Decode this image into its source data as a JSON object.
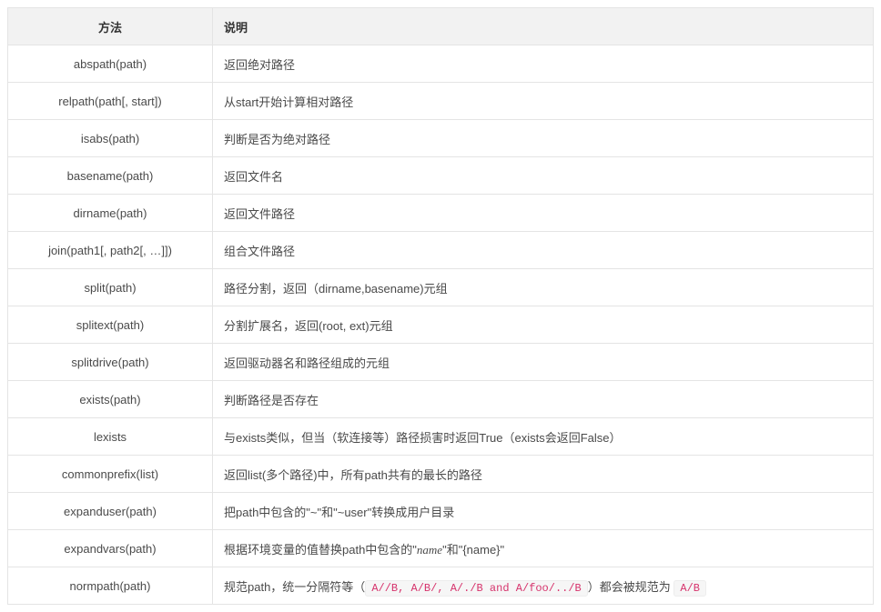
{
  "table": {
    "headers": {
      "method": "方法",
      "desc": "说明"
    },
    "rows": [
      {
        "method": "abspath(path)",
        "desc": "返回绝对路径"
      },
      {
        "method": "relpath(path[, start])",
        "desc": "从start开始计算相对路径"
      },
      {
        "method": "isabs(path)",
        "desc": "判断是否为绝对路径"
      },
      {
        "method": "basename(path)",
        "desc": "返回文件名"
      },
      {
        "method": "dirname(path)",
        "desc": "返回文件路径"
      },
      {
        "method": "join(path1[, path2[, …]])",
        "desc": "组合文件路径"
      },
      {
        "method": "split(path)",
        "desc": "路径分割，返回（dirname,basename)元组"
      },
      {
        "method": "splitext(path)",
        "desc": "分割扩展名，返回(root, ext)元组"
      },
      {
        "method": "splitdrive(path)",
        "desc": "返回驱动器名和路径组成的元组"
      },
      {
        "method": "exists(path)",
        "desc": "判断路径是否存在"
      },
      {
        "method": "lexists",
        "desc": "与exists类似，但当（软连接等）路径损害时返回True（exists会返回False）"
      },
      {
        "method": "commonprefix(list)",
        "desc": "返回list(多个路径)中，所有path共有的最长的路径"
      },
      {
        "method": "expanduser(path)",
        "desc": "把path中包含的\"~\"和\"~user\"转换成用户目录"
      },
      {
        "method": "expandvars(path)",
        "desc_parts": {
          "before": "根据环境变量的值替换path中包含的\"",
          "math": "name",
          "after": "\"和\"{name}\""
        }
      },
      {
        "method": "normpath(path)",
        "norm": {
          "before": "规范path，统一分隔符等（",
          "code1": "A//B, A/B/, A/./B and A/foo/../B",
          "mid": "）都会被规范为 ",
          "code2": "A/B"
        }
      }
    ]
  }
}
